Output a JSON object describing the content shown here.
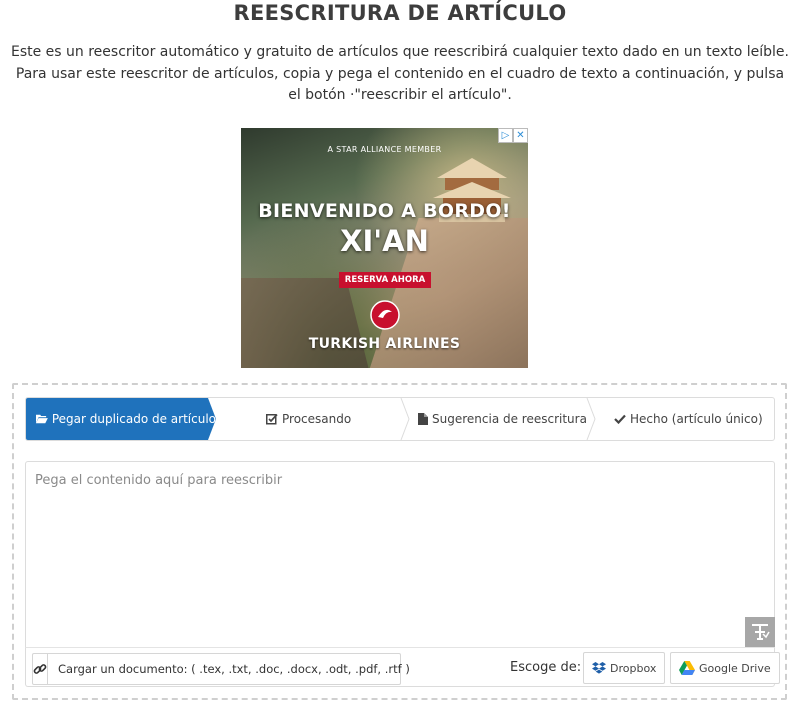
{
  "page": {
    "title": "REESCRITURA DE ARTÍCULO",
    "description": "Este es un reescritor automático y gratuito de artículos que reescribirá cualquier texto dado en un texto leíble. Para usar este reescritor de artículos, copia y pega el contenido en el cuadro de texto a continuación, y pulsa el botón ·\"reescribir el artículo\"."
  },
  "ad": {
    "alliance": "A STAR ALLIANCE MEMBER",
    "headline": "BIENVENIDO A BORDO!",
    "city": "XI'AN",
    "cta": "RESERVA AHORA",
    "brand": "TURKISH AIRLINES"
  },
  "steps": [
    {
      "label": "Pegar duplicado de artículo",
      "icon": "folder-open-icon"
    },
    {
      "label": "Procesando",
      "icon": "edit-check-icon"
    },
    {
      "label": "Sugerencia de reescritura",
      "icon": "file-icon"
    },
    {
      "label": "Hecho (artículo único)",
      "icon": "check-icon"
    }
  ],
  "editor": {
    "placeholder": "Pega el contenido aquí para reescribir"
  },
  "upload": {
    "label": "Cargar un documento: ( .tex, .txt, .doc, .docx, .odt, .pdf, .rtf )"
  },
  "sources": {
    "label": "Escoge de:",
    "dropbox": "Dropbox",
    "gdrive": "Google Drive"
  },
  "colors": {
    "active_step": "#1f72bc",
    "ad_cta": "#c8102e"
  }
}
